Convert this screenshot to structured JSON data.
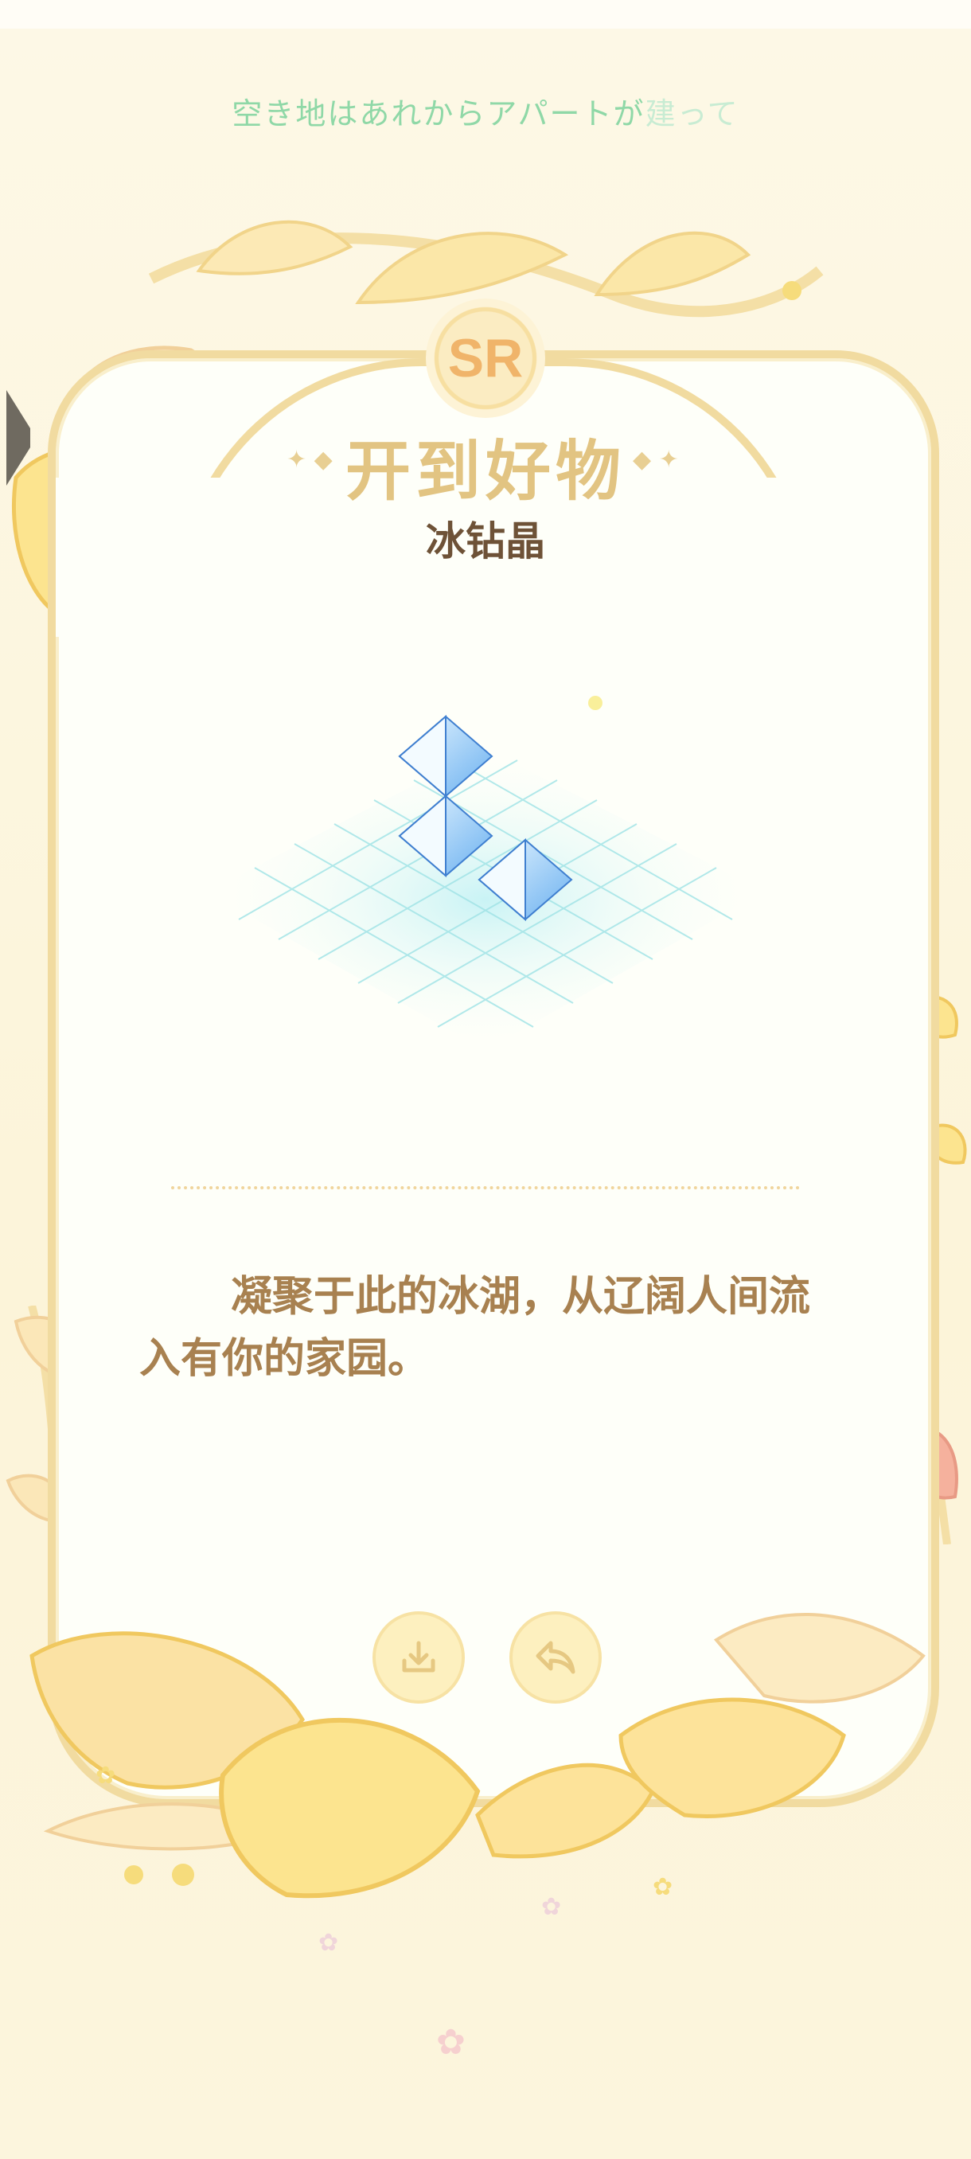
{
  "marquee": {
    "text_main": "空き地はあれからアパートが",
    "text_fade": "建って"
  },
  "badge": {
    "rarity": "SR"
  },
  "card": {
    "title": "开到好物",
    "item_name": "冰钻晶",
    "description": "凝聚于此的冰湖，从辽阔人间流入有你的家园。"
  },
  "actions": {
    "download_icon": "download-icon",
    "share_icon": "share-arrow-icon"
  },
  "colors": {
    "accent": "#e2c482",
    "text_brown": "#a88150",
    "marquee_green": "#8fd8a7",
    "button_fill": "#fdf0bf"
  }
}
